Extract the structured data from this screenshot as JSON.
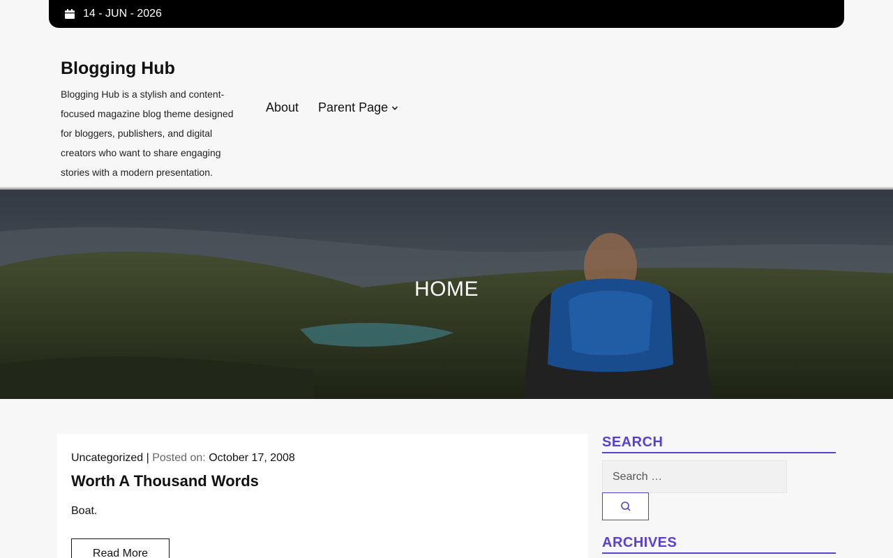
{
  "topbar": {
    "date": "14 - JUN - 2026"
  },
  "brand": {
    "title": "Blogging Hub",
    "description": "Blogging Hub is a stylish and content-focused magazine blog theme designed for bloggers, publishers, and digital creators who want to share engaging stories with a modern presentation."
  },
  "nav": {
    "items": [
      {
        "label": "About"
      },
      {
        "label": "Parent Page"
      }
    ]
  },
  "hero": {
    "title": "HOME"
  },
  "post": {
    "category": "Uncategorized",
    "separator": "|",
    "posted_label": "Posted on:",
    "date": "October 17, 2008",
    "title": "Worth A Thousand Words",
    "excerpt": "Boat.",
    "read_more": "Read More"
  },
  "sidebar": {
    "search_title": "SEARCH",
    "search_placeholder": "Search …",
    "archives_title": "ARCHIVES"
  },
  "colors": {
    "accent": "#5b3fd0",
    "topbar": "#000000"
  }
}
